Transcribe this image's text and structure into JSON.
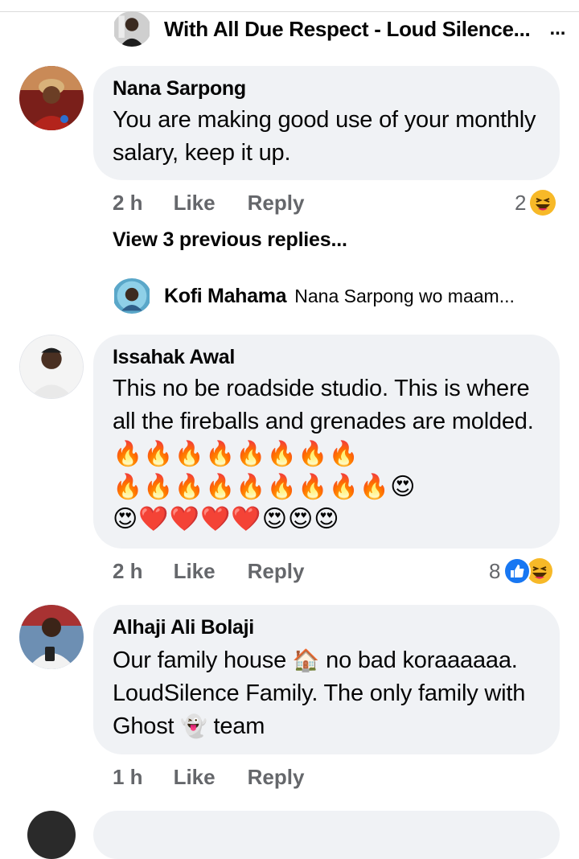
{
  "thread_header": {
    "name": "With All Due Respect - Loud Silence...",
    "more": "..."
  },
  "comments": [
    {
      "author": "Nana Sarpong",
      "text": "You are making good use of your monthly salary, keep it up.",
      "time": "2 h",
      "like": "Like",
      "reply": "Reply",
      "reaction_count": "2",
      "reactions": [
        "haha-icon"
      ]
    },
    {
      "author": "Issahak Awal",
      "text": "This no be roadside studio. This is where all the fireballs and grenades are molded.",
      "emoji_line1": "🔥🔥🔥🔥🔥🔥🔥🔥",
      "emoji_line2": "🔥🔥🔥🔥🔥🔥🔥🔥🔥😍",
      "emoji_line3": "😍❤️❤️❤️❤️😍😍😍",
      "time": "2 h",
      "like": "Like",
      "reply": "Reply",
      "reaction_count": "8",
      "reactions": [
        "like-icon",
        "haha-icon"
      ]
    },
    {
      "author": "Alhaji Ali Bolaji",
      "text_part1": "Our family house",
      "house_emoji": "🏠",
      "text_part2": "no bad koraaaaaa. LoudSilence Family. The only family with Ghost",
      "ghost_emoji": "👻",
      "text_part3": "team",
      "time": "1 h",
      "like": "Like",
      "reply": "Reply"
    }
  ],
  "view_previous": "View 3 previous replies...",
  "latest_reply": {
    "name": "Kofi Mahama",
    "snippet": "Nana Sarpong wo maam..."
  },
  "colors": {
    "bubble": "#f0f2f5",
    "meta_text": "#65676b",
    "like_blue": "#1877f2",
    "haha_yellow": "#f7b928"
  }
}
